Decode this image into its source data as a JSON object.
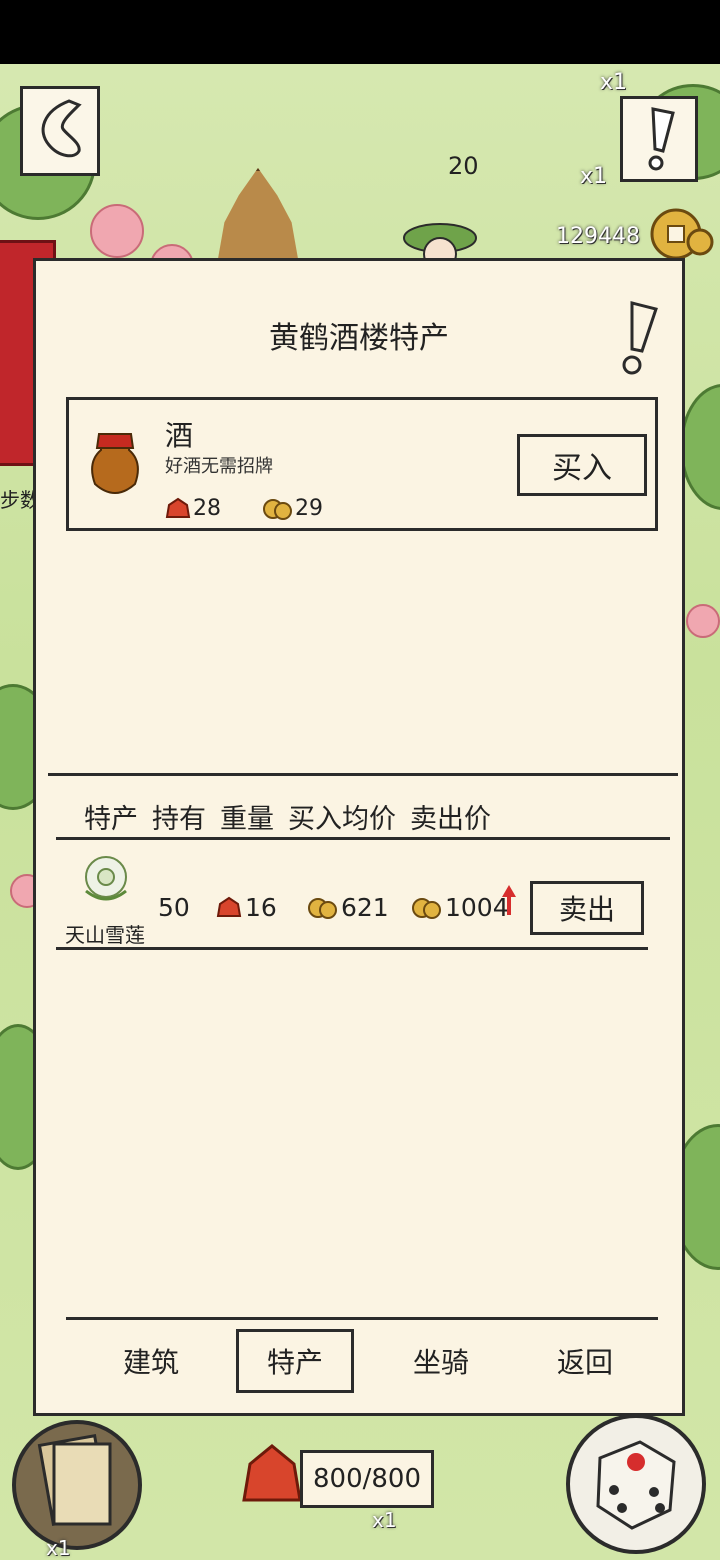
{
  "hud": {
    "coins": "129448",
    "multiplier_a": "x1",
    "multiplier_b": "x1",
    "steps_label": "步数",
    "boat_number": "20",
    "stamina": "800/800",
    "deck_mult": "x1",
    "chest_mult": "x1"
  },
  "panel": {
    "title": "黄鹤酒楼特产",
    "item": {
      "name": "酒",
      "description": "好酒无需招牌",
      "weight": "28",
      "price": "29",
      "buy_label": "买入"
    },
    "inventory_headers": [
      "特产",
      "持有",
      "重量",
      "买入均价",
      "卖出价"
    ],
    "inventory": [
      {
        "name": "天山雪莲",
        "held": "50",
        "weight": "16",
        "avg_buy_price": "621",
        "sell_price": "1004",
        "trend": "up",
        "sell_label": "卖出"
      }
    ],
    "tabs": [
      {
        "label": "建筑",
        "active": false
      },
      {
        "label": "特产",
        "active": true
      },
      {
        "label": "坐骑",
        "active": false
      },
      {
        "label": "返回",
        "active": false
      }
    ]
  },
  "colors": {
    "panel_bg": "#fbf4e3",
    "ink": "#2b2b2b",
    "trend_up": "#d62d2d"
  }
}
